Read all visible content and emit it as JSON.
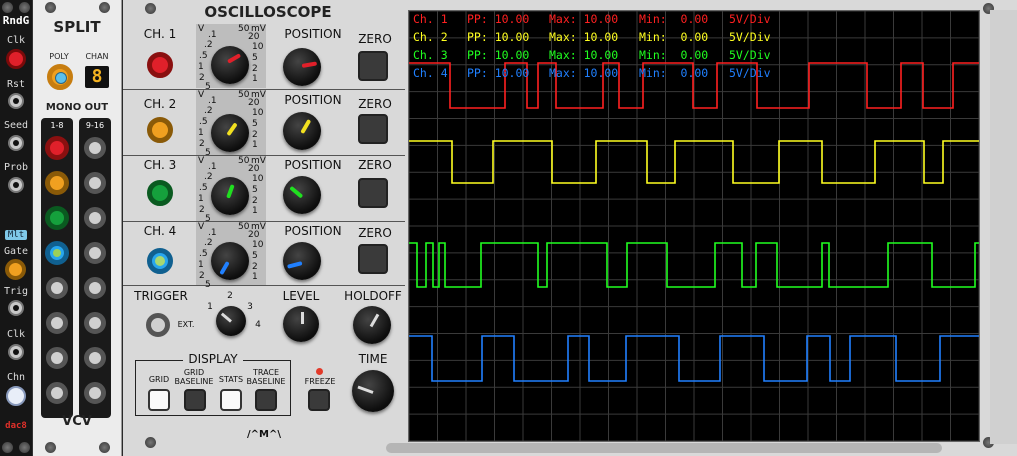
{
  "rndg": {
    "title": "RndG",
    "inputs": [
      "Clk",
      "Rst",
      "Seed",
      "Prob"
    ],
    "mlt_label": "Mlt",
    "outputs": [
      "Gate",
      "Trig",
      "Clk",
      "Chn"
    ],
    "brand": "dac8"
  },
  "split": {
    "title": "SPLIT",
    "poly_label": "POLY",
    "chan_label": "CHAN",
    "chan_value": "8",
    "mono_out_label": "MONO OUT",
    "bank1_label": "1-8",
    "bank2_label": "9-16",
    "brand": "VCV"
  },
  "scope": {
    "title": "OSCILLOSCOPE",
    "channels": [
      {
        "label": "CH. 1",
        "position_label": "POSITION",
        "zero_label": "ZERO",
        "color": "#e0202a"
      },
      {
        "label": "CH. 2",
        "position_label": "POSITION",
        "zero_label": "ZERO",
        "color": "#f2c018"
      },
      {
        "label": "CH. 3",
        "position_label": "POSITION",
        "zero_label": "ZERO",
        "color": "#15a03c"
      },
      {
        "label": "CH. 4",
        "position_label": "POSITION",
        "zero_label": "ZERO",
        "color": "#28a6ee"
      }
    ],
    "volt_scale_v": [
      "V",
      ".1",
      ".2",
      ".5",
      "1",
      "2",
      "5"
    ],
    "volt_scale_mv": [
      "50",
      "mV",
      "20",
      "10",
      "5",
      "2",
      "1"
    ],
    "trigger_label": "TRIGGER",
    "ext_label": "EXT.",
    "trigger_ticks": [
      "1",
      "2",
      "3",
      "4"
    ],
    "level_label": "LEVEL",
    "holdoff_label": "HOLDOFF",
    "display_label": "DISPLAY",
    "display_buttons": [
      "GRID",
      "GRID BASELINE",
      "STATS",
      "TRACE BASELINE"
    ],
    "freeze_label": "FREEZE",
    "time_label": "TIME",
    "logo": "/^M^\\"
  },
  "screen": {
    "stats": [
      {
        "ch": "Ch. 1",
        "pp": "PP: 10.00",
        "max": "Max: 10.00",
        "min": "Min:  0.00",
        "div": "5V/Div",
        "color": "#ff2020"
      },
      {
        "ch": "Ch. 2",
        "pp": "PP: 10.00",
        "max": "Max: 10.00",
        "min": "Min:  0.00",
        "div": "5V/Div",
        "color": "#ffff20"
      },
      {
        "ch": "Ch. 3",
        "pp": "PP: 10.00",
        "max": "Max: 10.00",
        "min": "Min:  0.00",
        "div": "5V/Div",
        "color": "#20ff20"
      },
      {
        "ch": "Ch. 4",
        "pp": "PP: 10.00",
        "max": "Max: 10.00",
        "min": "Min:  0.00",
        "div": "5V/Div",
        "color": "#2080ff"
      }
    ]
  }
}
